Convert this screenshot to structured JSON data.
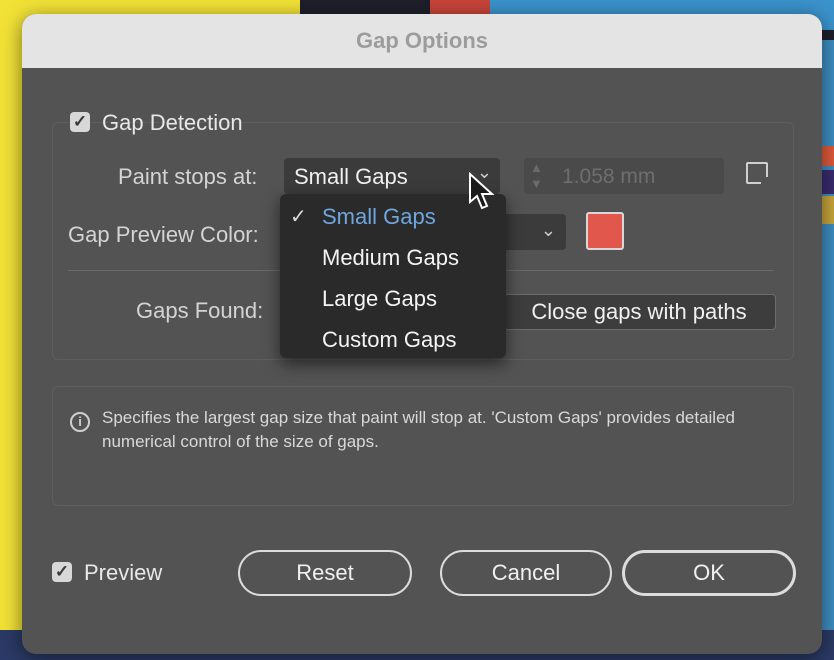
{
  "dialog": {
    "title": "Gap Options"
  },
  "gap_detection": {
    "label": "Gap Detection",
    "checked": true
  },
  "paint_stops": {
    "label": "Paint stops at:",
    "selected": "Small Gaps",
    "size_value": "1.058 mm",
    "options": [
      {
        "label": "Small Gaps",
        "selected": true
      },
      {
        "label": "Medium Gaps",
        "selected": false
      },
      {
        "label": "Large Gaps",
        "selected": false
      },
      {
        "label": "Custom Gaps",
        "selected": false
      }
    ]
  },
  "preview_color": {
    "label": "Gap Preview Color:",
    "swatch_color": "#e2574c"
  },
  "gaps_found": {
    "label": "Gaps Found:",
    "close_button": "Close gaps with paths"
  },
  "info": {
    "text": "Specifies the largest gap size that paint will stop at. 'Custom Gaps' provides detailed numerical control of the size of gaps."
  },
  "preview": {
    "label": "Preview",
    "checked": true
  },
  "buttons": {
    "reset": "Reset",
    "cancel": "Cancel",
    "ok": "OK"
  },
  "icons": {
    "check": "✓",
    "chevron": "⌄",
    "info": "i"
  },
  "colors": {
    "accent_selected": "#6ea7e0",
    "dialog_bg": "#535353"
  }
}
